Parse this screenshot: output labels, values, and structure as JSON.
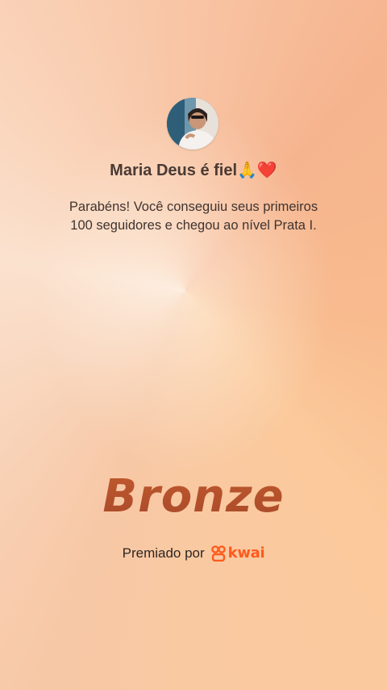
{
  "profile": {
    "name": "Maria Deus é fiel🙏❤️"
  },
  "message": {
    "line1": "Parabéns! Você conseguiu seus primeiros",
    "line2": "100 seguidores e chegou ao nível Prata I."
  },
  "badge": {
    "title": "Bronze"
  },
  "award": {
    "label": "Premiado por",
    "brand": "kwai"
  },
  "icons": {
    "avatar": "profile-photo",
    "brand_logo": "kwai-logo-icon"
  },
  "colors": {
    "badge_text": "#b4532c",
    "brand": "#ff5a1e"
  }
}
